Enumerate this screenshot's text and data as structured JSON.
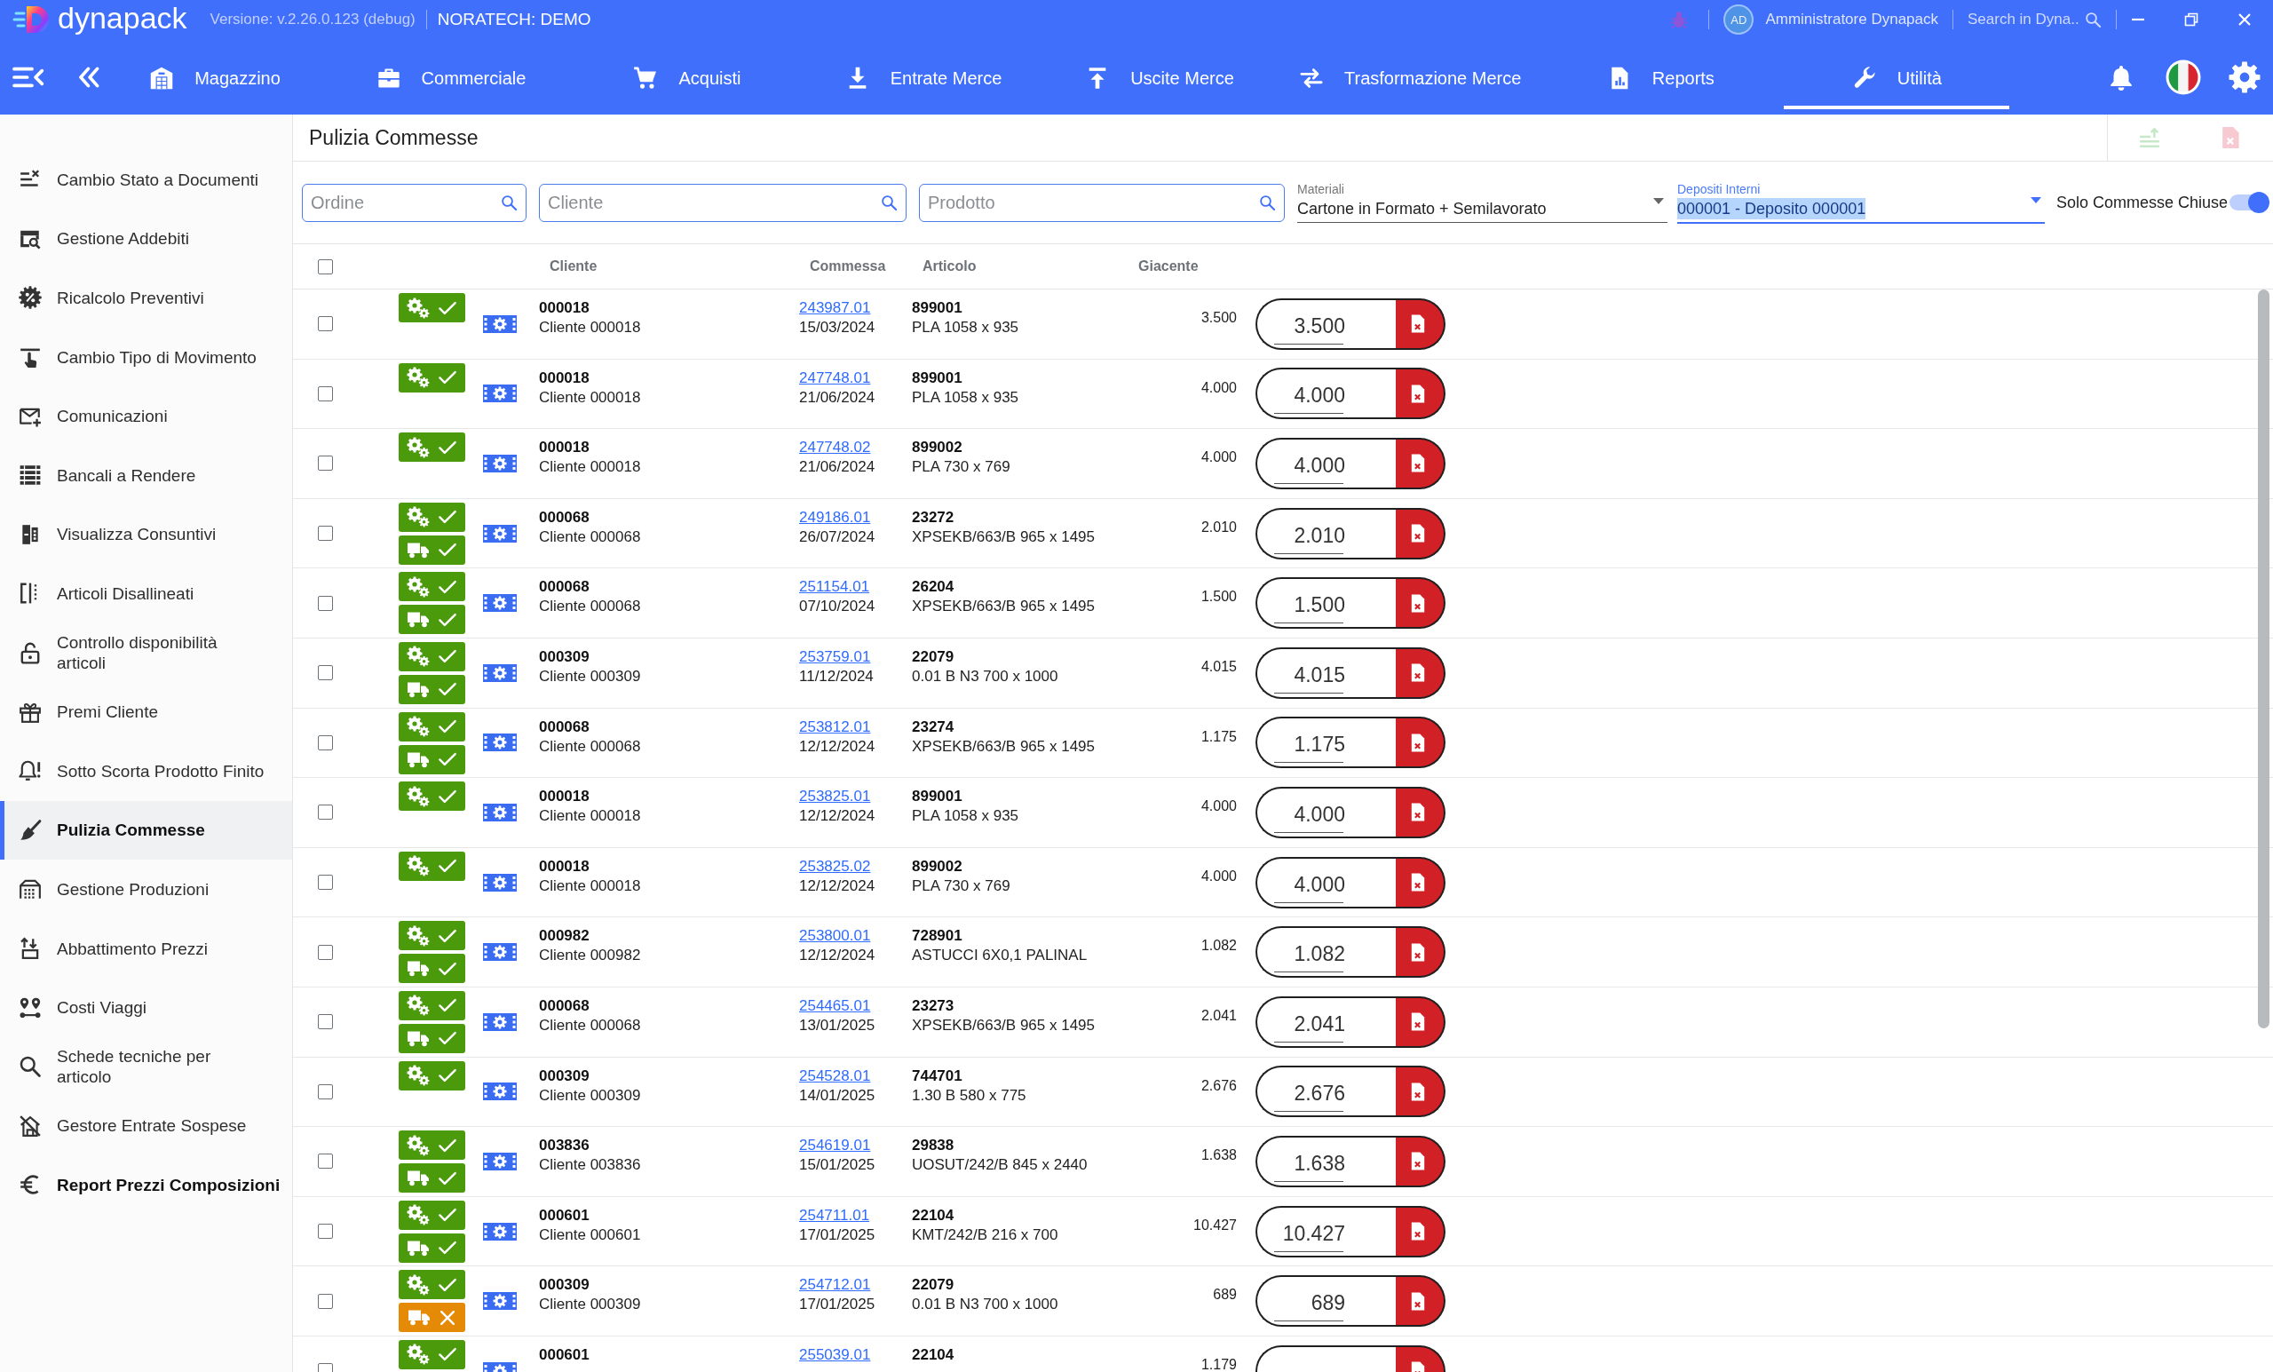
{
  "app_bar": {
    "logo": "dynapack",
    "version": "Versione: v.2.26.0.123 (debug)",
    "company": "NORATECH: DEMO",
    "user": {
      "initials": "AD",
      "name": "Amministratore Dynapack"
    },
    "search": {
      "placeholder": "Search in Dyna.."
    }
  },
  "nav": {
    "tabs": [
      {
        "label": "Magazzino",
        "selected": false
      },
      {
        "label": "Commerciale",
        "selected": false
      },
      {
        "label": "Acquisti",
        "selected": false
      },
      {
        "label": "Entrate Merce",
        "selected": false
      },
      {
        "label": "Uscite Merce",
        "selected": false
      },
      {
        "label": "Trasformazione Merce",
        "selected": false
      },
      {
        "label": "Reports",
        "selected": false
      },
      {
        "label": "Utilità",
        "selected": true
      }
    ]
  },
  "sidebar": {
    "items": [
      {
        "label": "Cambio Stato a Documenti",
        "selected": false,
        "emphasized": false
      },
      {
        "label": "Gestione Addebiti",
        "selected": false,
        "emphasized": false
      },
      {
        "label": "Ricalcolo Preventivi",
        "selected": false,
        "emphasized": false
      },
      {
        "label": "Cambio Tipo di Movimento",
        "selected": false,
        "emphasized": false
      },
      {
        "label": "Comunicazioni",
        "selected": false,
        "emphasized": false
      },
      {
        "label": "Bancali a Rendere",
        "selected": false,
        "emphasized": false
      },
      {
        "label": "Visualizza Consuntivi",
        "selected": false,
        "emphasized": false
      },
      {
        "label": "Articoli Disallineati",
        "selected": false,
        "emphasized": false
      },
      {
        "label": "Controllo disponibilità articoli",
        "selected": false,
        "emphasized": false
      },
      {
        "label": "Premi Cliente",
        "selected": false,
        "emphasized": false
      },
      {
        "label": "Sotto Scorta Prodotto Finito",
        "selected": false,
        "emphasized": false
      },
      {
        "label": "Pulizia Commesse",
        "selected": true,
        "emphasized": false
      },
      {
        "label": "Gestione Produzioni",
        "selected": false,
        "emphasized": false
      },
      {
        "label": "Abbattimento Prezzi",
        "selected": false,
        "emphasized": false
      },
      {
        "label": "Costi Viaggi",
        "selected": false,
        "emphasized": false
      },
      {
        "label": "Schede tecniche per articolo",
        "selected": false,
        "emphasized": false
      },
      {
        "label": "Gestore Entrate Sospese",
        "selected": false,
        "emphasized": false
      },
      {
        "label": "Report Prezzi Composizioni",
        "selected": false,
        "emphasized": true
      }
    ]
  },
  "page": {
    "title": "Pulizia Commesse",
    "actions": [
      {
        "disabled": true
      },
      {
        "disabled": true
      }
    ]
  },
  "filters": {
    "search_fields": [
      {
        "placeholder": "Ordine"
      },
      {
        "placeholder": "Cliente"
      },
      {
        "placeholder": "Prodotto"
      }
    ],
    "dropdowns": [
      {
        "label": "Materiali",
        "value": "Cartone in Formato + Semilavorato",
        "focused": false
      },
      {
        "label": "Depositi Interni",
        "value": "000001 - Deposito 000001",
        "focused": true
      }
    ],
    "toggle": {
      "label": "Solo Commesse Chiuse",
      "on": true
    }
  },
  "table": {
    "select_all": {
      "checked": false
    },
    "columns": [
      "Cliente",
      "Commessa",
      "Articolo",
      "Giacente"
    ],
    "rows": [
      {
        "checked": false,
        "statuses": [
          {
            "kind": "production",
            "ok": true
          }
        ],
        "customer_code": "000018",
        "customer_name": "Cliente 000018",
        "order": "243987.01",
        "date": "15/03/2024",
        "article_code": "899001",
        "article": "PLA 1058 x 935",
        "stock": "3.500",
        "quantity": "3.500"
      },
      {
        "checked": false,
        "statuses": [
          {
            "kind": "production",
            "ok": true
          }
        ],
        "customer_code": "000018",
        "customer_name": "Cliente 000018",
        "order": "247748.01",
        "date": "21/06/2024",
        "article_code": "899001",
        "article": "PLA 1058 x 935",
        "stock": "4.000",
        "quantity": "4.000"
      },
      {
        "checked": false,
        "statuses": [
          {
            "kind": "production",
            "ok": true
          }
        ],
        "customer_code": "000018",
        "customer_name": "Cliente 000018",
        "order": "247748.02",
        "date": "21/06/2024",
        "article_code": "899002",
        "article": "PLA 730 x 769",
        "stock": "4.000",
        "quantity": "4.000"
      },
      {
        "checked": false,
        "statuses": [
          {
            "kind": "production",
            "ok": true
          },
          {
            "kind": "delivery",
            "ok": true
          }
        ],
        "customer_code": "000068",
        "customer_name": "Cliente 000068",
        "order": "249186.01",
        "date": "26/07/2024",
        "article_code": "23272",
        "article": "XPSEKB/663/B 965 x 1495",
        "stock": "2.010",
        "quantity": "2.010"
      },
      {
        "checked": false,
        "statuses": [
          {
            "kind": "production",
            "ok": true
          },
          {
            "kind": "delivery",
            "ok": true
          }
        ],
        "customer_code": "000068",
        "customer_name": "Cliente 000068",
        "order": "251154.01",
        "date": "07/10/2024",
        "article_code": "26204",
        "article": "XPSEKB/663/B 965 x 1495",
        "stock": "1.500",
        "quantity": "1.500"
      },
      {
        "checked": false,
        "statuses": [
          {
            "kind": "production",
            "ok": true
          },
          {
            "kind": "delivery",
            "ok": true
          }
        ],
        "customer_code": "000309",
        "customer_name": "Cliente 000309",
        "order": "253759.01",
        "date": "11/12/2024",
        "article_code": "22079",
        "article": "0.01 B N3 700 x 1000",
        "stock": "4.015",
        "quantity": "4.015"
      },
      {
        "checked": false,
        "statuses": [
          {
            "kind": "production",
            "ok": true
          },
          {
            "kind": "delivery",
            "ok": true
          }
        ],
        "customer_code": "000068",
        "customer_name": "Cliente 000068",
        "order": "253812.01",
        "date": "12/12/2024",
        "article_code": "23274",
        "article": "XPSEKB/663/B 965 x 1495",
        "stock": "1.175",
        "quantity": "1.175"
      },
      {
        "checked": false,
        "statuses": [
          {
            "kind": "production",
            "ok": true
          }
        ],
        "customer_code": "000018",
        "customer_name": "Cliente 000018",
        "order": "253825.01",
        "date": "12/12/2024",
        "article_code": "899001",
        "article": "PLA 1058 x 935",
        "stock": "4.000",
        "quantity": "4.000"
      },
      {
        "checked": false,
        "statuses": [
          {
            "kind": "production",
            "ok": true
          }
        ],
        "customer_code": "000018",
        "customer_name": "Cliente 000018",
        "order": "253825.02",
        "date": "12/12/2024",
        "article_code": "899002",
        "article": "PLA 730 x 769",
        "stock": "4.000",
        "quantity": "4.000"
      },
      {
        "checked": false,
        "statuses": [
          {
            "kind": "production",
            "ok": true
          },
          {
            "kind": "delivery",
            "ok": true
          }
        ],
        "customer_code": "000982",
        "customer_name": "Cliente 000982",
        "order": "253800.01",
        "date": "12/12/2024",
        "article_code": "728901",
        "article": "ASTUCCI 6X0,1 PALINAL",
        "stock": "1.082",
        "quantity": "1.082"
      },
      {
        "checked": false,
        "statuses": [
          {
            "kind": "production",
            "ok": true
          },
          {
            "kind": "delivery",
            "ok": true
          }
        ],
        "customer_code": "000068",
        "customer_name": "Cliente 000068",
        "order": "254465.01",
        "date": "13/01/2025",
        "article_code": "23273",
        "article": "XPSEKB/663/B 965 x 1495",
        "stock": "2.041",
        "quantity": "2.041"
      },
      {
        "checked": false,
        "statuses": [
          {
            "kind": "production",
            "ok": true
          }
        ],
        "customer_code": "000309",
        "customer_name": "Cliente 000309",
        "order": "254528.01",
        "date": "14/01/2025",
        "article_code": "744701",
        "article": "1.30 B 580 x 775",
        "stock": "2.676",
        "quantity": "2.676"
      },
      {
        "checked": false,
        "statuses": [
          {
            "kind": "production",
            "ok": true
          },
          {
            "kind": "delivery",
            "ok": true
          }
        ],
        "customer_code": "003836",
        "customer_name": "Cliente 003836",
        "order": "254619.01",
        "date": "15/01/2025",
        "article_code": "29838",
        "article": "UOSUT/242/B 845 x 2440",
        "stock": "1.638",
        "quantity": "1.638"
      },
      {
        "checked": false,
        "statuses": [
          {
            "kind": "production",
            "ok": true
          },
          {
            "kind": "delivery",
            "ok": true
          }
        ],
        "customer_code": "000601",
        "customer_name": "Cliente 000601",
        "order": "254711.01",
        "date": "17/01/2025",
        "article_code": "22104",
        "article": "KMT/242/B 216 x 700",
        "stock": "10.427",
        "quantity": "10.427"
      },
      {
        "checked": false,
        "statuses": [
          {
            "kind": "production",
            "ok": true
          },
          {
            "kind": "delivery",
            "ok": false
          }
        ],
        "customer_code": "000309",
        "customer_name": "Cliente 000309",
        "order": "254712.01",
        "date": "17/01/2025",
        "article_code": "22079",
        "article": "0.01 B N3 700 x 1000",
        "stock": "689",
        "quantity": "689"
      },
      {
        "checked": false,
        "statuses": [
          {
            "kind": "production",
            "ok": true
          }
        ],
        "customer_code": "000601",
        "order": "255039.01",
        "article_code": "22104",
        "stock": "1.179"
      }
    ]
  }
}
